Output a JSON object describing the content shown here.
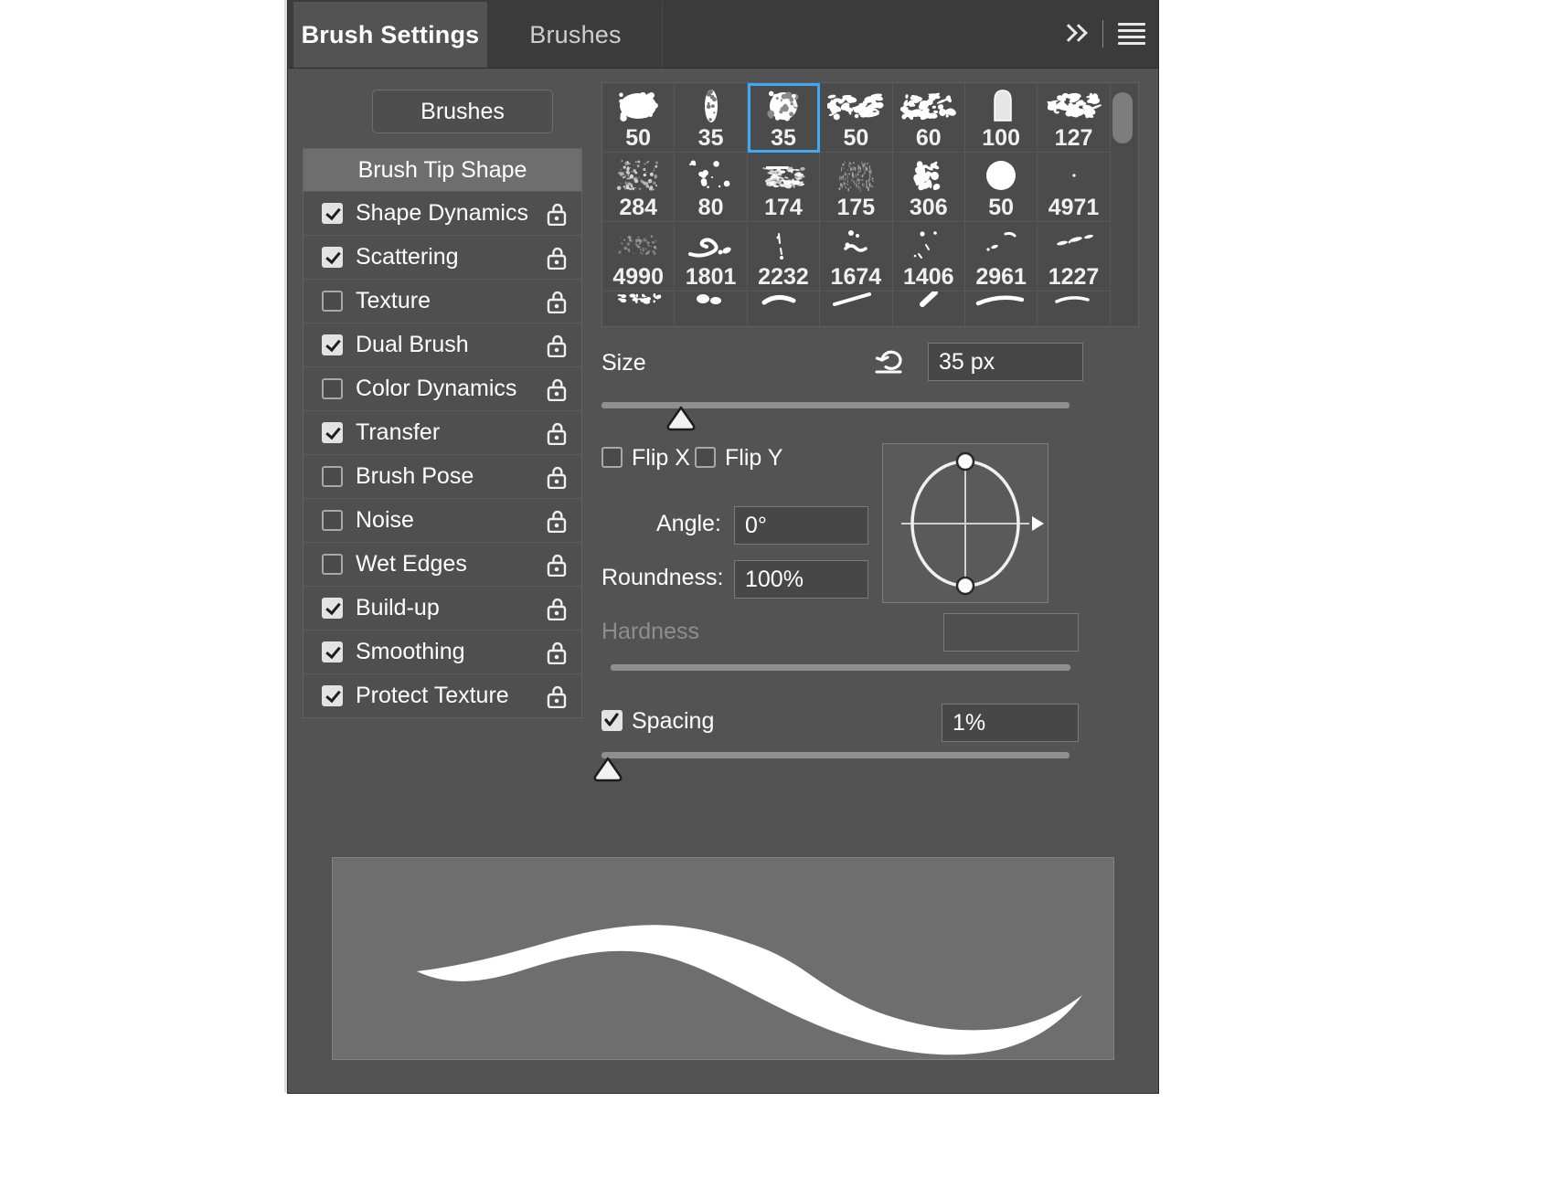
{
  "panel": {
    "tabs": [
      {
        "label": "Brush Settings",
        "active": true
      },
      {
        "label": "Brushes",
        "active": false
      }
    ],
    "header_icons": {
      "expand": "chevron-double-right-icon",
      "menu": "hamburger-menu-icon"
    }
  },
  "sidebar": {
    "brushes_button": "Brushes",
    "header": "Brush Tip Shape",
    "options": [
      {
        "label": "Shape Dynamics",
        "checked": true
      },
      {
        "label": "Scattering",
        "checked": true
      },
      {
        "label": "Texture",
        "checked": false
      },
      {
        "label": "Dual Brush",
        "checked": true
      },
      {
        "label": "Color Dynamics",
        "checked": false
      },
      {
        "label": "Transfer",
        "checked": true
      },
      {
        "label": "Brush Pose",
        "checked": false
      },
      {
        "label": "Noise",
        "checked": false
      },
      {
        "label": "Wet Edges",
        "checked": false
      },
      {
        "label": "Build-up",
        "checked": true
      },
      {
        "label": "Smoothing",
        "checked": true
      },
      {
        "label": "Protect Texture",
        "checked": true
      }
    ],
    "lock_icon": "unlocked-padlock-icon"
  },
  "brush_grid": {
    "selected_index": 2,
    "scrollbar": "vertical-scrollbar-thumb",
    "presets": [
      {
        "size": "50",
        "shape": "soft-round-blob"
      },
      {
        "size": "35",
        "shape": "narrow-speckled"
      },
      {
        "size": "35",
        "shape": "round-rough"
      },
      {
        "size": "50",
        "shape": "scatter-chalk"
      },
      {
        "size": "60",
        "shape": "scatter-chalk-2"
      },
      {
        "size": "100",
        "shape": "flat-thumb"
      },
      {
        "size": "127",
        "shape": "rough-streak"
      },
      {
        "size": "284",
        "shape": "fine-spatter"
      },
      {
        "size": "80",
        "shape": "sparse-dots"
      },
      {
        "size": "174",
        "shape": "smudge-dense"
      },
      {
        "size": "175",
        "shape": "fine-vertical-grain"
      },
      {
        "size": "306",
        "shape": "splatter-star"
      },
      {
        "size": "50",
        "shape": "soft-round"
      },
      {
        "size": "4971",
        "shape": "tiny-speck"
      },
      {
        "size": "4990",
        "shape": "faint-grain"
      },
      {
        "size": "1801",
        "shape": "swoosh-stroke"
      },
      {
        "size": "2232",
        "shape": "thin-drip"
      },
      {
        "size": "1674",
        "shape": "scatter-marks"
      },
      {
        "size": "1406",
        "shape": "sparse-flecks"
      },
      {
        "size": "2961",
        "shape": "small-dashes"
      },
      {
        "size": "1227",
        "shape": "dash-line"
      },
      {
        "size": "",
        "shape": "partial-dotted-row"
      },
      {
        "size": "",
        "shape": "partial-blob-row"
      },
      {
        "size": "",
        "shape": "partial-smear"
      },
      {
        "size": "",
        "shape": "partial-streak"
      },
      {
        "size": "",
        "shape": "partial-slash"
      },
      {
        "size": "",
        "shape": "partial-sweep"
      },
      {
        "size": "",
        "shape": "partial-wisp"
      }
    ]
  },
  "controls": {
    "size": {
      "label": "Size",
      "value": "35 px",
      "reset_icon": "reset-arrow-icon",
      "slider_percent": 17
    },
    "flip_x": {
      "label": "Flip X",
      "checked": false
    },
    "flip_y": {
      "label": "Flip Y",
      "checked": false
    },
    "angle": {
      "label": "Angle:",
      "value": "0°"
    },
    "roundness": {
      "label": "Roundness:",
      "value": "100%"
    },
    "angle_widget": {
      "name": "angle-roundness-dial",
      "angle_degrees": 0,
      "roundness_percent": 100
    },
    "hardness": {
      "label": "Hardness",
      "value": "",
      "disabled": true,
      "slider_percent": 0
    },
    "spacing": {
      "label": "Spacing",
      "checked": true,
      "value": "1%",
      "slider_percent": 1
    }
  },
  "preview": {
    "name": "brush-stroke-preview"
  },
  "colors": {
    "panel_bg": "#535353",
    "tabbar_bg": "#3b3b3b",
    "selection_blue": "#3fa9f5",
    "text": "#ffffff",
    "disabled_text": "#8e8e8e",
    "field_bg": "#474747",
    "preview_bg": "#6e6e6e"
  }
}
